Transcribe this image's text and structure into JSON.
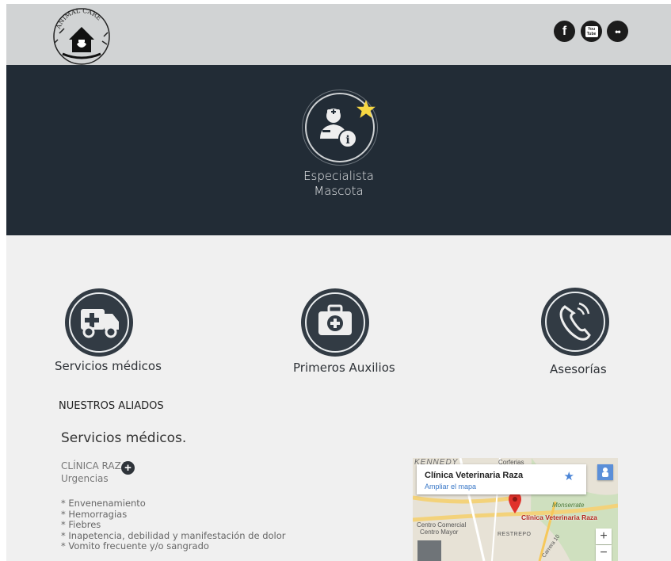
{
  "header": {
    "logo_text": "ANIMAL CARE",
    "social": [
      {
        "icon": "facebook-icon",
        "label": "f"
      },
      {
        "icon": "youtube-icon",
        "label": "You Tube"
      },
      {
        "icon": "flickr-icon",
        "label": "••"
      }
    ]
  },
  "hero": {
    "label_line1": "Especialista",
    "label_line2": "Mascota",
    "icon": "veterinarian-info-icon"
  },
  "services": [
    {
      "label": "Servicios médicos",
      "icon": "ambulance-icon"
    },
    {
      "label": "Primeros Auxilios",
      "icon": "first-aid-kit-icon"
    },
    {
      "label": "Asesorías",
      "icon": "phone-call-icon"
    }
  ],
  "aliados": {
    "title": "NUESTROS ALIADOS",
    "subtitle": "Servicios médicos.",
    "clinic": {
      "name": "CLÍNICA RAZA",
      "category": "Urgencias",
      "symptoms": [
        "* Envenenamiento",
        "* Hemorragias",
        "* Fiebres",
        "* Inapetencia, debilidad y manifestación de dolor",
        "* Vomito frecuente y/o sangrado"
      ]
    }
  },
  "map": {
    "card_title": "Clínica Veterinaria Raza",
    "card_link": "Ampliar el mapa",
    "marker_label": "Clínica Veterinaria Raza",
    "labels": {
      "kennedy": "KENNEDY",
      "corferias": "Corferias",
      "monserrate": "Monserrate",
      "centro_comercial_1": "Centro Comercial",
      "centro_comercial_2": "Centro Mayor",
      "restrepo": "RESTREPO",
      "carrera": "Carrera 10"
    },
    "zoom_in": "+",
    "zoom_out": "−"
  },
  "colors": {
    "header_bg": "#d1d3d4",
    "hero_bg": "#222c36",
    "content_bg": "#f0f0f0",
    "icon_bg": "#323b44",
    "star": "#f7d843"
  }
}
